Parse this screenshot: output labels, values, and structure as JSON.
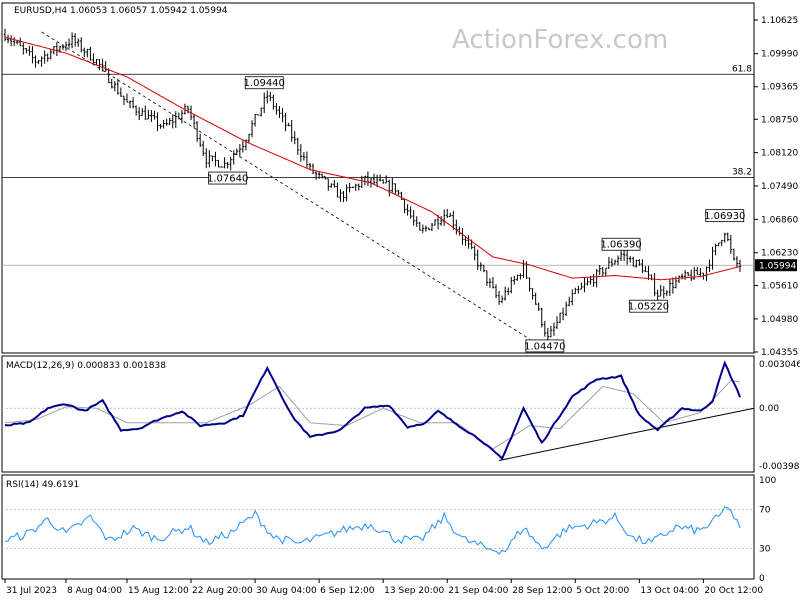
{
  "header": {
    "price_title": "EURUSD,H4  1.06053 1.06057 1.05942 1.05994",
    "macd_title": "MACD(12,26,9) 0.000833 0.001838",
    "rsi_title": "RSI(14) 49.6191"
  },
  "watermark": "ActionForex.com",
  "colors": {
    "candles": "#000000",
    "ma": "#d00000",
    "macd": "#00008b",
    "macd_signal": "#a0a0a0",
    "rsi": "#1e90ff",
    "grid": "#b0b0b0"
  },
  "chart_data": [
    {
      "type": "candlestick",
      "title": "EURUSD,H4",
      "header_values": {
        "open": 1.06053,
        "high": 1.06057,
        "low": 1.05942,
        "close": 1.05994
      },
      "ylim": [
        1.04355,
        1.10625
      ],
      "y_ticks": [
        "1.10625",
        "1.09990",
        "1.09365",
        "1.08750",
        "1.08120",
        "1.07490",
        "1.06860",
        "1.06230",
        "1.05610",
        "1.04980",
        "1.04355"
      ],
      "current_price": "1.05994",
      "price_keys": [
        {
          "i": 0,
          "v": 1.1035
        },
        {
          "i": 10,
          "v": 1.0985
        },
        {
          "i": 22,
          "v": 1.1025
        },
        {
          "i": 30,
          "v": 1.0985
        },
        {
          "i": 40,
          "v": 1.0905
        },
        {
          "i": 52,
          "v": 1.086
        },
        {
          "i": 60,
          "v": 1.0895
        },
        {
          "i": 66,
          "v": 1.08
        },
        {
          "i": 72,
          "v": 1.079
        },
        {
          "i": 78,
          "v": 1.083
        },
        {
          "i": 86,
          "v": 1.092
        },
        {
          "i": 92,
          "v": 1.0865
        },
        {
          "i": 100,
          "v": 1.078
        },
        {
          "i": 110,
          "v": 1.073
        },
        {
          "i": 118,
          "v": 1.076
        },
        {
          "i": 128,
          "v": 1.0745
        },
        {
          "i": 136,
          "v": 1.066
        },
        {
          "i": 145,
          "v": 1.07
        },
        {
          "i": 154,
          "v": 1.0615
        },
        {
          "i": 162,
          "v": 1.053
        },
        {
          "i": 170,
          "v": 1.0595
        },
        {
          "i": 178,
          "v": 1.046
        },
        {
          "i": 186,
          "v": 1.054
        },
        {
          "i": 194,
          "v": 1.058
        },
        {
          "i": 202,
          "v": 1.062
        },
        {
          "i": 209,
          "v": 1.0595
        },
        {
          "i": 214,
          "v": 1.0545
        },
        {
          "i": 222,
          "v": 1.0575
        },
        {
          "i": 229,
          "v": 1.0585
        },
        {
          "i": 236,
          "v": 1.0665
        },
        {
          "i": 239,
          "v": 1.0605
        },
        {
          "i": 241,
          "v": 1.0599
        }
      ],
      "ma_keys": [
        {
          "i": 0,
          "v": 1.103
        },
        {
          "i": 20,
          "v": 1.1
        },
        {
          "i": 40,
          "v": 1.0955
        },
        {
          "i": 60,
          "v": 1.089
        },
        {
          "i": 80,
          "v": 1.083
        },
        {
          "i": 100,
          "v": 1.078
        },
        {
          "i": 120,
          "v": 1.0755
        },
        {
          "i": 140,
          "v": 1.07
        },
        {
          "i": 160,
          "v": 1.0615
        },
        {
          "i": 172,
          "v": 1.06
        },
        {
          "i": 186,
          "v": 1.0575
        },
        {
          "i": 200,
          "v": 1.058
        },
        {
          "i": 215,
          "v": 1.0572
        },
        {
          "i": 228,
          "v": 1.0578
        },
        {
          "i": 241,
          "v": 1.0597
        }
      ],
      "fib_levels": [
        {
          "label": "61.8",
          "value": 1.096
        },
        {
          "label": "38.2",
          "value": 1.0765
        }
      ],
      "price_labels": [
        {
          "text": "1.09440",
          "i": 85,
          "value": 1.0944
        },
        {
          "text": "1.07640",
          "i": 73,
          "value": 1.0764
        },
        {
          "text": "1.06390",
          "i": 202,
          "value": 1.0639
        },
        {
          "text": "1.05220",
          "i": 211,
          "value": 1.0522
        },
        {
          "text": "1.04470",
          "i": 177,
          "value": 1.0447
        },
        {
          "text": "1.06930",
          "i": 236,
          "value": 1.0693
        }
      ],
      "trendline": [
        {
          "i": 12,
          "v": 1.104
        },
        {
          "i": 172,
          "v": 1.046
        }
      ],
      "current_line": 1.05994
    },
    {
      "type": "line",
      "title": "MACD(12,26,9)",
      "header_values": {
        "macd": 0.000833,
        "signal": 0.001838
      },
      "ylim": [
        -0.003981,
        0.003046
      ],
      "y_ticks": [
        "0.003046",
        "0.00",
        "-0.003981"
      ],
      "macd_keys": [
        {
          "i": 0,
          "v": -0.0012
        },
        {
          "i": 8,
          "v": -0.001
        },
        {
          "i": 14,
          "v": 0.0
        },
        {
          "i": 20,
          "v": 0.0003
        },
        {
          "i": 26,
          "v": -0.0002
        },
        {
          "i": 32,
          "v": 0.0005
        },
        {
          "i": 38,
          "v": -0.0015
        },
        {
          "i": 44,
          "v": -0.0014
        },
        {
          "i": 50,
          "v": -0.0008
        },
        {
          "i": 58,
          "v": -0.0002
        },
        {
          "i": 64,
          "v": -0.0012
        },
        {
          "i": 72,
          "v": -0.001
        },
        {
          "i": 78,
          "v": -0.0005
        },
        {
          "i": 86,
          "v": 0.0028
        },
        {
          "i": 94,
          "v": -0.0005
        },
        {
          "i": 100,
          "v": -0.002
        },
        {
          "i": 110,
          "v": -0.0015
        },
        {
          "i": 118,
          "v": 0.0
        },
        {
          "i": 126,
          "v": 0.0002
        },
        {
          "i": 132,
          "v": -0.0013
        },
        {
          "i": 138,
          "v": -0.001
        },
        {
          "i": 142,
          "v": -0.0002
        },
        {
          "i": 146,
          "v": -0.0008
        },
        {
          "i": 156,
          "v": -0.0022
        },
        {
          "i": 163,
          "v": -0.0035
        },
        {
          "i": 170,
          "v": 0.0
        },
        {
          "i": 176,
          "v": -0.0024
        },
        {
          "i": 186,
          "v": 0.0008
        },
        {
          "i": 194,
          "v": 0.002
        },
        {
          "i": 202,
          "v": 0.0022
        },
        {
          "i": 208,
          "v": -0.0005
        },
        {
          "i": 214,
          "v": -0.0015
        },
        {
          "i": 222,
          "v": 0.0
        },
        {
          "i": 228,
          "v": -0.0002
        },
        {
          "i": 232,
          "v": 0.0005
        },
        {
          "i": 236,
          "v": 0.0031
        },
        {
          "i": 241,
          "v": 0.0008
        }
      ],
      "signal_keys": [
        {
          "i": 0,
          "v": -0.001
        },
        {
          "i": 10,
          "v": -0.0008
        },
        {
          "i": 20,
          "v": 0.0001
        },
        {
          "i": 30,
          "v": 0.0
        },
        {
          "i": 40,
          "v": -0.001
        },
        {
          "i": 52,
          "v": -0.001
        },
        {
          "i": 66,
          "v": -0.001
        },
        {
          "i": 80,
          "v": 0.0002
        },
        {
          "i": 90,
          "v": 0.0015
        },
        {
          "i": 100,
          "v": -0.001
        },
        {
          "i": 112,
          "v": -0.0012
        },
        {
          "i": 124,
          "v": 0.0
        },
        {
          "i": 136,
          "v": -0.001
        },
        {
          "i": 148,
          "v": -0.001
        },
        {
          "i": 160,
          "v": -0.0028
        },
        {
          "i": 172,
          "v": -0.0012
        },
        {
          "i": 182,
          "v": -0.0014
        },
        {
          "i": 196,
          "v": 0.0015
        },
        {
          "i": 206,
          "v": 0.001
        },
        {
          "i": 216,
          "v": -0.001
        },
        {
          "i": 228,
          "v": -0.0003
        },
        {
          "i": 238,
          "v": 0.0019
        },
        {
          "i": 241,
          "v": 0.0018
        }
      ],
      "trendline": [
        {
          "i": 162,
          "v": -0.0036
        },
        {
          "i": 241,
          "v": 0.0
        }
      ]
    },
    {
      "type": "line",
      "title": "RSI(14)",
      "header_values": {
        "rsi": 49.6191
      },
      "ylim": [
        0,
        100
      ],
      "y_ticks": [
        "100",
        "70",
        "30",
        "0"
      ],
      "levels": [
        70,
        30
      ],
      "rsi_keys": [
        {
          "i": 0,
          "v": 38
        },
        {
          "i": 8,
          "v": 46
        },
        {
          "i": 14,
          "v": 60
        },
        {
          "i": 20,
          "v": 45
        },
        {
          "i": 28,
          "v": 62
        },
        {
          "i": 34,
          "v": 38
        },
        {
          "i": 42,
          "v": 50
        },
        {
          "i": 50,
          "v": 40
        },
        {
          "i": 60,
          "v": 52
        },
        {
          "i": 66,
          "v": 36
        },
        {
          "i": 74,
          "v": 46
        },
        {
          "i": 82,
          "v": 65
        },
        {
          "i": 88,
          "v": 42
        },
        {
          "i": 96,
          "v": 35
        },
        {
          "i": 104,
          "v": 42
        },
        {
          "i": 112,
          "v": 50
        },
        {
          "i": 120,
          "v": 55
        },
        {
          "i": 128,
          "v": 40
        },
        {
          "i": 136,
          "v": 38
        },
        {
          "i": 144,
          "v": 62
        },
        {
          "i": 150,
          "v": 40
        },
        {
          "i": 158,
          "v": 30
        },
        {
          "i": 164,
          "v": 28
        },
        {
          "i": 170,
          "v": 52
        },
        {
          "i": 176,
          "v": 30
        },
        {
          "i": 184,
          "v": 50
        },
        {
          "i": 192,
          "v": 55
        },
        {
          "i": 200,
          "v": 62
        },
        {
          "i": 206,
          "v": 40
        },
        {
          "i": 212,
          "v": 36
        },
        {
          "i": 220,
          "v": 52
        },
        {
          "i": 228,
          "v": 48
        },
        {
          "i": 234,
          "v": 62
        },
        {
          "i": 237,
          "v": 74
        },
        {
          "i": 241,
          "v": 49.6
        }
      ]
    }
  ],
  "x_axis": {
    "bar_count": 242,
    "labels": [
      {
        "text": "31 Jul 2023",
        "i": 0
      },
      {
        "text": "8 Aug 04:00",
        "i": 20
      },
      {
        "text": "15 Aug 12:00",
        "i": 40
      },
      {
        "text": "22 Aug 20:00",
        "i": 61
      },
      {
        "text": "30 Aug 04:00",
        "i": 82
      },
      {
        "text": "6 Sep 12:00",
        "i": 103
      },
      {
        "text": "13 Sep 20:00",
        "i": 124
      },
      {
        "text": "21 Sep 04:00",
        "i": 145
      },
      {
        "text": "28 Sep 12:00",
        "i": 166
      },
      {
        "text": "5 Oct 20:00",
        "i": 187
      },
      {
        "text": "13 Oct 04:00",
        "i": 208
      },
      {
        "text": "20 Oct 12:00",
        "i": 229
      }
    ]
  }
}
